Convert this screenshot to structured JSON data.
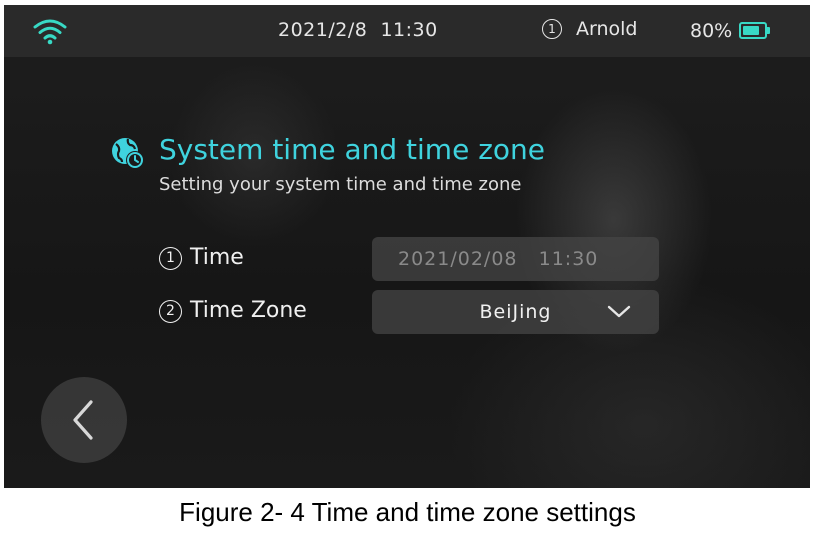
{
  "status_bar": {
    "date": "2021/2/8",
    "time": "11:30",
    "user_number": "1",
    "user_name": "Arnold",
    "battery_percent_text": "80%",
    "battery_level": 0.8,
    "accent_color": "#38d9c5"
  },
  "header": {
    "icon": "globe-clock-icon",
    "title": "System time and time zone",
    "subtitle": "Setting your system time and time zone"
  },
  "settings": {
    "time": {
      "number": "1",
      "label": "Time",
      "value": "2021/02/08   11:30"
    },
    "time_zone": {
      "number": "2",
      "label": "Time Zone",
      "value": "BeiJing",
      "dropdown_icon": "chevron-down-icon"
    }
  },
  "navigation": {
    "back_icon": "chevron-left-icon"
  },
  "caption": "Figure 2- 4 Time and time zone settings"
}
